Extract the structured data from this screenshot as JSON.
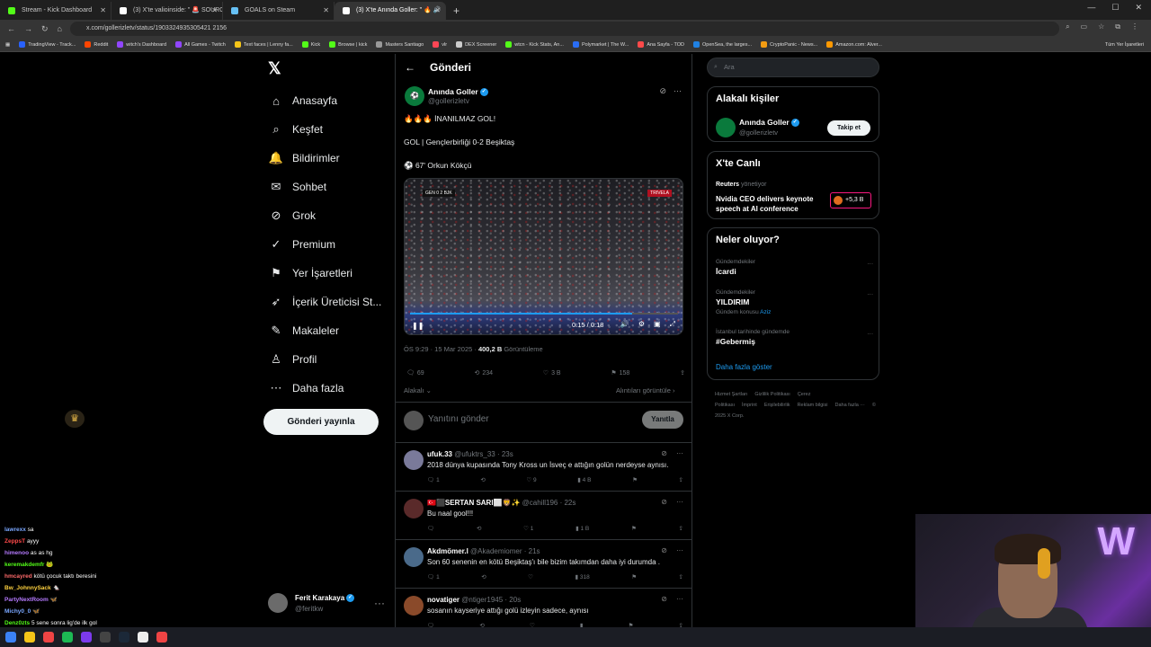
{
  "browser": {
    "tabs": [
      {
        "title": "Stream - Kick Dashboard",
        "color": "#53fc18",
        "active": false
      },
      {
        "title": "(3) X'te valioinside: \" 🚨 SOURC",
        "color": "#ffffff",
        "active": false
      },
      {
        "title": "GOALS on Steam",
        "color": "#66c0f4",
        "active": false
      },
      {
        "title": "(3) X'te Anında Goller: \" 🔥 🔊",
        "color": "#ffffff",
        "active": true
      }
    ],
    "url": "x.com/gollerizletv/status/1903324935305421 2156",
    "bookmarks": [
      "TradingView - Track...",
      "Reddit",
      "witch's Dashboard",
      "All Games - Twitch",
      "Text faces | Lenny fa...",
      "Kick",
      "Browse | kick",
      "Masters Santiago",
      "vlr",
      "DEX Screener",
      "wtcn - Kick Stats, An...",
      "Polymarket | The W...",
      "Ana Sayfa - TOD",
      "OpenSea, the larges...",
      "CryptoPanic - News...",
      "Amazon.com: Alver..."
    ],
    "bookmarks_right": "Tüm Yer İşaretleri"
  },
  "nav": {
    "items": [
      {
        "label": "Anasayfa",
        "icon": "home-icon",
        "glyph": "⌂"
      },
      {
        "label": "Keşfet",
        "icon": "search-icon",
        "glyph": "⌕"
      },
      {
        "label": "Bildirimler",
        "icon": "bell-icon",
        "glyph": "🔔"
      },
      {
        "label": "Sohbet",
        "icon": "mail-icon",
        "glyph": "✉"
      },
      {
        "label": "Grok",
        "icon": "grok-icon",
        "glyph": "⊘"
      },
      {
        "label": "Premium",
        "icon": "premium-icon",
        "glyph": "✓"
      },
      {
        "label": "Yer İşaretleri",
        "icon": "bookmark-icon",
        "glyph": "⚑"
      },
      {
        "label": "İçerik Üreticisi St...",
        "icon": "rocket-icon",
        "glyph": "➶"
      },
      {
        "label": "Makaleler",
        "icon": "article-icon",
        "glyph": "✎"
      },
      {
        "label": "Profil",
        "icon": "profile-icon",
        "glyph": "♙"
      },
      {
        "label": "Daha fazla",
        "icon": "more-icon",
        "glyph": "⋯"
      }
    ],
    "post_button": "Gönderi yayınla",
    "account": {
      "name": "Ferit Karakaya",
      "handle": "@feritkw"
    }
  },
  "main": {
    "header": "Gönderi",
    "post": {
      "author": "Anında Goller",
      "handle": "@gollerizletv",
      "line1": "🔥🔥🔥 İNANILMAZ GOL!",
      "line2": "GOL | Gençlerbirliği 0-2 Beşiktaş",
      "line3": "⚽ 67' Orkun Kökçü",
      "video": {
        "teams": "GEN 0 2 BJK",
        "brand": "TRIVELA",
        "time": "0:15 / 0:18",
        "progress": 0.83
      },
      "time": "ÖS 9:29 · 15 Mar 2025 ·",
      "views": "400,2 B",
      "views_label": "Görüntüleme",
      "stats": {
        "replies": "69",
        "reposts": "234",
        "likes": "3 B",
        "bookmarks": "158"
      },
      "related": "Alakalı",
      "quotes": "Alıntıları görüntüle"
    },
    "reply_box": {
      "placeholder": "Yanıtını gönder",
      "button": "Yanıtla"
    },
    "replies": [
      {
        "name": "ufuk.33",
        "handle": "@ufuktrs_33 · 23s",
        "text": "2018 dünya kupasında Tony Kross un İsveç e attığın golün nerdeyse aynısı.",
        "r": "1",
        "rt": "",
        "l": "9",
        "v": "4 B",
        "color": "#7a7a9a"
      },
      {
        "name": "🇹🇷⬛SERTAN SARI⬜🦁✨",
        "handle": "@cahill196 · 22s",
        "text": "Bu naal gool!!!",
        "r": "",
        "rt": "",
        "l": "1",
        "v": "1 B",
        "color": "#5a2a2a"
      },
      {
        "name": "Akdmömer.l",
        "handle": "@Akademiomer · 21s",
        "text": "Son 60 senenin en kötü Beşiktaş'ı bile bizim takımdan daha iyi durumda .",
        "r": "1",
        "rt": "",
        "l": "",
        "v": "318",
        "color": "#4a6a8a"
      },
      {
        "name": "novatiger",
        "handle": "@ntiger1945 · 20s",
        "text": "sosanın kayseriye attığı golü izleyin sadece, aynısı",
        "r": "",
        "rt": "",
        "l": "",
        "v": "",
        "color": "#8a4a2a"
      }
    ]
  },
  "sidebar": {
    "search_placeholder": "Ara",
    "related_title": "Alakalı kişiler",
    "related_person": {
      "name": "Anında Goller",
      "handle": "@gollerizletv",
      "follow": "Takip et"
    },
    "live_title": "X'te Canlı",
    "live": {
      "source": "Reuters",
      "source_sub": "yönetiyor",
      "text": "Nvidia CEO delivers keynote speech at AI conference",
      "count": "+5,3 B"
    },
    "trends_title": "Neler oluyor?",
    "trends": [
      {
        "category": "Gündemdekiler",
        "name": "İcardi",
        "sub": "",
        "sub_link": ""
      },
      {
        "category": "Gündemdekiler",
        "name": "YILDIRIM",
        "sub": "Gündem konusu",
        "sub_link": "Aziz"
      },
      {
        "category": "İstanbul tarihinde gündemde",
        "name": "#Gebermiş",
        "sub": "",
        "sub_link": ""
      }
    ],
    "show_more": "Daha fazla göster",
    "footer": [
      "Hizmet Şartları",
      "Gizlilik Politikası",
      "Çerez Politikası",
      "İmprint",
      "Erişilebilirlik",
      "Reklam bilgisi",
      "Daha fazla ···",
      "© 2025 X Corp."
    ]
  },
  "chat": [
    {
      "user": "lawrexx",
      "color": "#7aa7ff",
      "msg": "sa"
    },
    {
      "user": "ZeppsT",
      "color": "#ff4a4a",
      "msg": "ayyy"
    },
    {
      "user": "himenoo",
      "color": "#b57aff",
      "msg": "as as hg"
    },
    {
      "user": "keremakdemfr",
      "color": "#53fc18",
      "msg": "🐸"
    },
    {
      "user": "hmcayred",
      "color": "#ff6a6a",
      "msg": "kötü çocuk taktı beresini"
    },
    {
      "user": "Bw_JohnnySack",
      "color": "#ffd23f",
      "msg": "🐁"
    },
    {
      "user": "PartyNextRoom",
      "color": "#b57aff",
      "msg": "🦋"
    },
    {
      "user": "Michy0_0",
      "color": "#7aa7ff",
      "msg": "🦋"
    },
    {
      "user": "Denz0zts",
      "color": "#53fc18",
      "msg": "5 sene sonra lig'de ilk gol"
    },
    {
      "user": "halidiss",
      "color": "#53fc18",
      "msg": "sıradan sa hg"
    }
  ]
}
